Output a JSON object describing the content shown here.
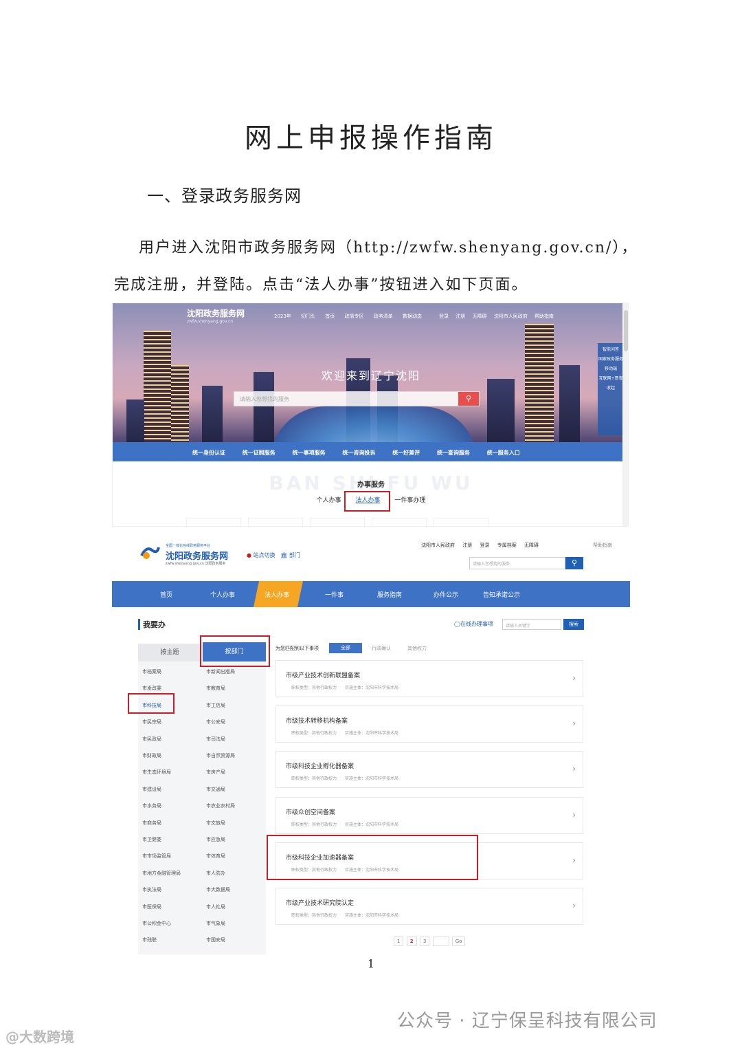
{
  "document": {
    "title": "网上申报操作指南",
    "section1": "一、登录政务服务网",
    "para_line1": "用户进入沈阳市政务服务网（http://zwfw.shenyang.gov.cn/），",
    "para_line2": "完成注册，并登陆。点击“法人办事”按钮进入如下页面。",
    "page_number": "1"
  },
  "shot1": {
    "logo": "沈阳政务服务网",
    "logo_url": "zwfw.shenyang.gov.cn",
    "nav": [
      "2023年",
      "切门头",
      "首页",
      "政情专区",
      "政务清单",
      "数据动态"
    ],
    "top_links": [
      "登录",
      "注册",
      "无障碍",
      "沈阳市人民政府",
      "帮助指南"
    ],
    "welcome": "欢迎来到辽宁沈阳",
    "search_placeholder": "请输入您想找的服务",
    "side": [
      "智能问答",
      "国家政务服务",
      "移动端",
      "互联网+督查",
      "收起"
    ],
    "bar": [
      "统一身份认证",
      "统一证照服务",
      "统一事项服务",
      "统一咨询投诉",
      "统一好差评",
      "统一查询服务",
      "统一服务入口"
    ],
    "bg_text": "BAN SHI FU WU",
    "svc_title": "办事服务",
    "svc_tabs": [
      "个人办事",
      "法人办事",
      "一件事办理"
    ]
  },
  "shot2": {
    "logo_sub": "全国一体化在线政务服务平台",
    "logo": "沈阳政务服务网",
    "logo_url": "zwfw.shenyang.gov.cn 沈阳政务服务",
    "location": "站点切换",
    "dept": "部门",
    "links": [
      "沈阳市人民政府",
      "注册",
      "登录",
      "专属档案",
      "无障碍"
    ],
    "help": "帮助指南",
    "search_placeholder": "请输入您想找的服务",
    "nav": [
      "首页",
      "个人办事",
      "法人办事",
      "一件事",
      "服务指南",
      "办件公示",
      "告知承诺公示"
    ],
    "want": "我要办",
    "online": "◯在线办理事项",
    "kw_placeholder": "请输入关键字",
    "kw_button": "搜索",
    "tab_theme": "按主题",
    "tab_dept": "按部门",
    "dept_col1": [
      "市档案局",
      "市发改委",
      "市科技局",
      "市民宗局",
      "市民政局",
      "市财政局",
      "市生态环境局",
      "市建设局",
      "市水务局",
      "市商务局",
      "市卫健委",
      "市市场监管局",
      "市地方金融管理局",
      "市执法局",
      "市医保局",
      "市公积金中心",
      "市残联"
    ],
    "dept_col2": [
      "市新闻出版局",
      "市教育局",
      "市工信局",
      "市公安局",
      "市司法局",
      "市自然资源局",
      "市房产局",
      "市交通局",
      "市农业农村局",
      "市文旅局",
      "市应急局",
      "市体育局",
      "市人防办",
      "市大数据局",
      "市人社局",
      "市气象局",
      "市国安局"
    ],
    "filter_label": "为您匹配到以下事项",
    "filter_all": "全部",
    "filter_opts": [
      "行政确认",
      "其他权力"
    ],
    "meta": "职权类型：其他行政权力　　实施主体：沈阳市科学技术局",
    "items": [
      "市级产业技术创新联盟备案",
      "市级技术转移机构备案",
      "市级科技企业孵化器备案",
      "市级众创空间备案",
      "市级科技企业加速器备案",
      "市级产业技术研究院认定"
    ],
    "pager": [
      "1",
      "2",
      "3",
      "Go"
    ]
  },
  "watermark": {
    "wechat": "公众号 · 辽宁保呈科技有限公司",
    "source": "@大数跨境"
  }
}
